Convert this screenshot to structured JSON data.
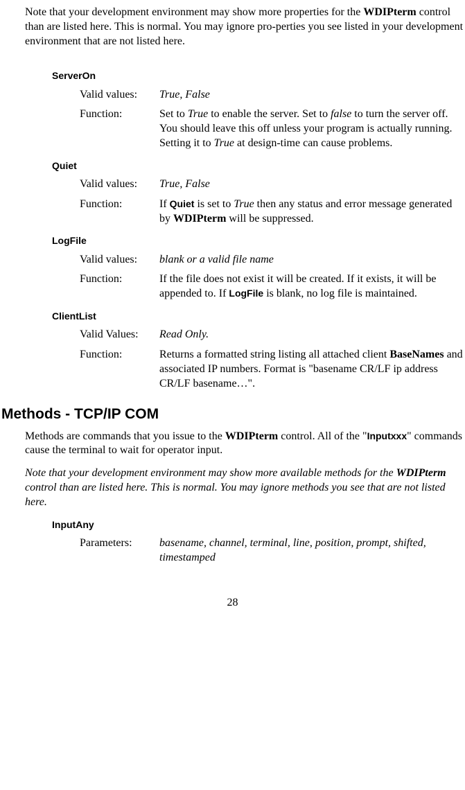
{
  "intro_note": {
    "part1": "Note that your development environment may show more properties for the ",
    "bold1": "WDIPterm",
    "part2": " control than are listed here. This is normal. You may ignore pro-perties you see listed in your development environment that are not listed here."
  },
  "properties": [
    {
      "name": "ServerOn",
      "valid_label": "Valid values:",
      "valid_value": "True, False",
      "function_label": "Function:",
      "function_parts": {
        "p1": "Set to ",
        "i1": "True",
        "p2": " to enable the server. Set to ",
        "i2": "false",
        "p3": " to turn the server off. You should leave this off unless your program is actually running. Setting it to ",
        "i3": "True",
        "p4": " at design-time can cause problems."
      }
    },
    {
      "name": "Quiet",
      "valid_label": "Valid values:",
      "valid_value": "True, False",
      "function_label": "Function:",
      "function_parts": {
        "p1": "If ",
        "b1": "Quiet",
        "p2": " is set to ",
        "i1": "True",
        "p3": " then any status and error message generated by ",
        "b2": "WDIPterm",
        "p4": " will be suppressed."
      }
    },
    {
      "name": "LogFile",
      "valid_label": "Valid values:",
      "valid_value": "blank or a valid file name",
      "function_label": "Function:",
      "function_parts": {
        "p1": "If the file does not exist it will be created. If it exists, it will be appended to. If ",
        "b1": "LogFile",
        "p2": " is blank, no log file is maintained."
      }
    },
    {
      "name": "ClientList",
      "valid_label": "Valid Values:",
      "valid_value": "Read Only.",
      "function_label": "Function:",
      "function_parts": {
        "p1": "Returns a formatted string listing all attached client ",
        "b1": "BaseNames",
        "p2": " and associated IP numbers. Format is \"basename CR/LF ip address CR/LF basename…\"."
      }
    }
  ],
  "section_heading": "Methods - TCP/IP COM",
  "methods_intro": {
    "p1a": "Methods are commands that you issue to the ",
    "b1": "WDIPterm",
    "p1b": " control. All of the \"",
    "b2": "Inputxxx",
    "p1c": "\" commands cause the terminal to wait for operator input."
  },
  "methods_note": {
    "p1": "Note that your development environment may show more available methods for the ",
    "b1": "WDIPterm",
    "p2": " control than are listed here. This is normal. You may ignore methods you see that are not listed here."
  },
  "method": {
    "name": "InputAny",
    "param_label": "Parameters:",
    "param_value": "basename, channel, terminal, line, position, prompt, shifted, timestamped"
  },
  "page_number": "28"
}
